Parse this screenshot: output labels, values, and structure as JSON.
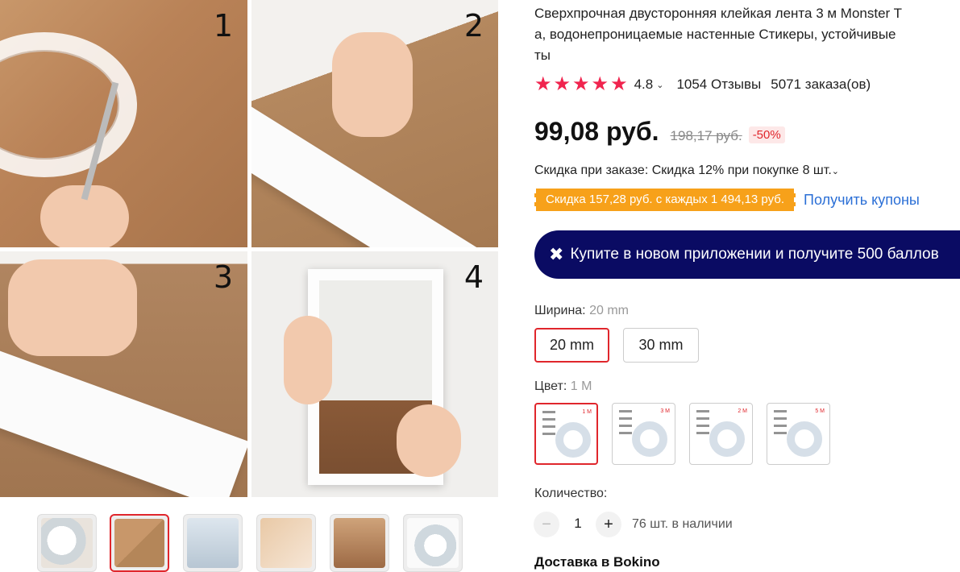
{
  "gallery": {
    "numbers": [
      "1",
      "2",
      "3",
      "4"
    ],
    "thumbnails": [
      "thumb-1",
      "thumb-2",
      "thumb-3",
      "thumb-4",
      "thumb-5",
      "thumb-6"
    ],
    "active_thumbnail": 1
  },
  "product": {
    "title": "Сверхпрочная двусторонняя клейкая лента 3 м Monster T\nа, водонепроницаемые настенные Стикеры, устойчивые\nты",
    "rating": "4.8",
    "reviews": "1054 Отзывы",
    "orders": "5071 заказа(ов)",
    "price": "99,08 руб.",
    "old_price": "198,17 руб.",
    "discount": "-50%",
    "order_discount": "Скидка при заказе: Скидка 12% при покупке 8 шт.",
    "coupon_text": "Скидка 157,28 руб. с каждых 1 494,13 руб.",
    "coupon_link": "Получить купоны",
    "app_banner": "Купите в новом приложении и получите 500 баллов"
  },
  "width": {
    "label": "Ширина:",
    "selected": "20 mm",
    "options": [
      "20 mm",
      "30 mm"
    ]
  },
  "color": {
    "label": "Цвет:",
    "selected": "1 M",
    "options": [
      "1 M",
      "3 M",
      "2 M",
      "5 M"
    ]
  },
  "quantity": {
    "label": "Количество:",
    "value": "1",
    "minus": "−",
    "plus": "+",
    "stock": "76 шт. в наличии"
  },
  "delivery": "Доставка в Bokino",
  "colors": {
    "star": "#f0244e",
    "accent_red": "#e0262c",
    "coupon_orange": "#f7a11a",
    "link_blue": "#2b6fd6",
    "banner_navy": "#0a0b63"
  }
}
